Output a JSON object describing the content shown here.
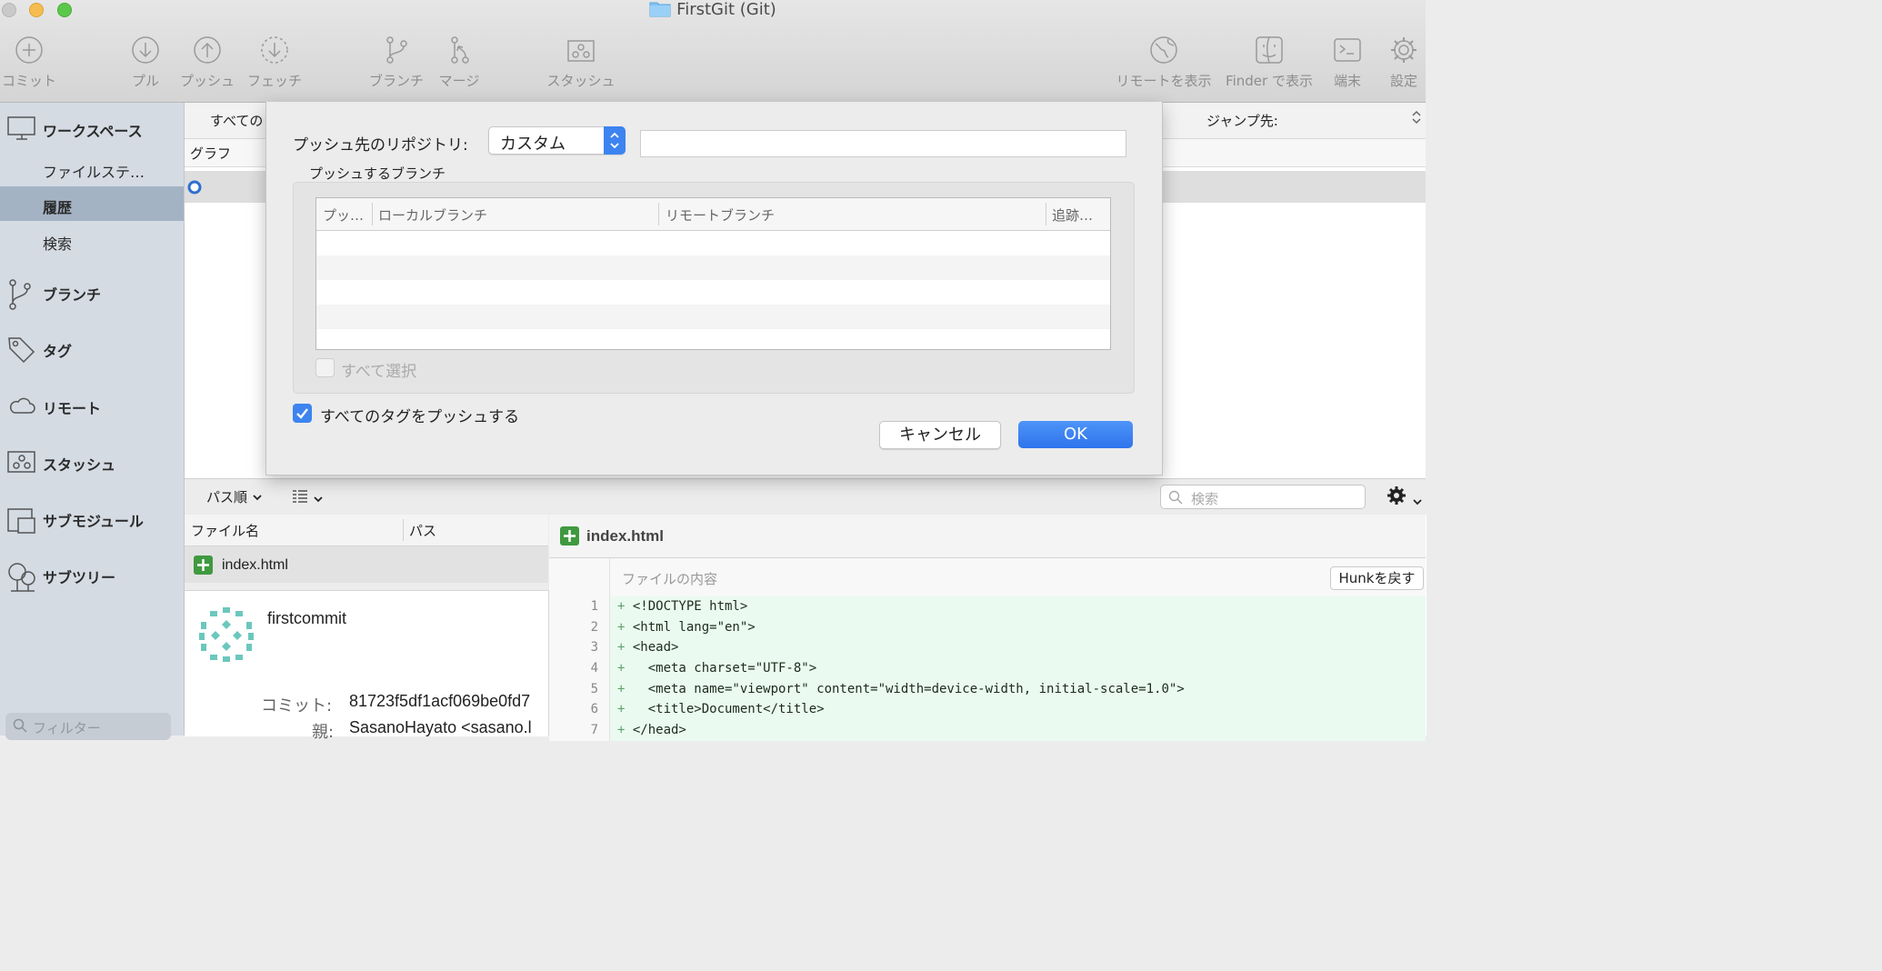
{
  "window": {
    "title": "FirstGit (Git)"
  },
  "toolbar": {
    "commit": "コミット",
    "pull": "プル",
    "push": "プッシュ",
    "fetch": "フェッチ",
    "branch": "ブランチ",
    "merge": "マージ",
    "stash": "スタッシュ",
    "show_remote": "リモートを表示",
    "show_finder": "Finder で表示",
    "terminal": "端末",
    "settings": "設定"
  },
  "sidebar": {
    "workspace": "ワークスペース",
    "file_status": "ファイルステ…",
    "history": "履歴",
    "search": "検索",
    "branches": "ブランチ",
    "tags": "タグ",
    "remotes": "リモート",
    "stashes": "スタッシュ",
    "submodules": "サブモジュール",
    "subtrees": "サブツリー",
    "filter_placeholder": "フィルター"
  },
  "main": {
    "branch_filter": "すべての",
    "jump_label": "ジャンプ先:",
    "graph_col": "グラフ"
  },
  "dialog": {
    "repo_label": "プッシュ先のリポジトリ:",
    "repo_value": "カスタム",
    "repo_url": "",
    "branches_group_label": "プッシュするブランチ",
    "col_push": "プッ…",
    "col_local": "ローカルブランチ",
    "col_remote": "リモートブランチ",
    "col_track": "追跡…",
    "select_all": "すべて選択",
    "select_all_checked": false,
    "push_tags": "すべてのタグをプッシュする",
    "push_tags_checked": true,
    "cancel": "キャンセル",
    "ok": "OK"
  },
  "bottom": {
    "sort_label": "パス順",
    "search_placeholder": "検索",
    "col_filename": "ファイル名",
    "col_path": "パス",
    "file_name": "index.html",
    "diff_file": "index.html",
    "file_content_label": "ファイルの内容",
    "revert_hunk": "Hunkを戻す"
  },
  "commit": {
    "message": "firstcommit",
    "commit_label": "コミット:",
    "commit_hash": "81723f5df1acf069be0fd7",
    "parent_label": "親:",
    "author": "SasanoHayato <sasano.l"
  },
  "diff_lines": [
    {
      "num": "1",
      "text": "<!DOCTYPE html>"
    },
    {
      "num": "2",
      "text": "<html lang=\"en\">"
    },
    {
      "num": "3",
      "text": "<head>"
    },
    {
      "num": "4",
      "text": "  <meta charset=\"UTF-8\">"
    },
    {
      "num": "5",
      "text": "  <meta name=\"viewport\" content=\"width=device-width, initial-scale=1.0\">"
    },
    {
      "num": "6",
      "text": "  <title>Document</title>"
    },
    {
      "num": "7",
      "text": "</head>"
    }
  ],
  "colors": {
    "accent": "#3d84f0",
    "sidebar_bg": "#d4dbe3",
    "sidebar_selected": "#a4b3c4",
    "diff_added_bg": "#eafaf0",
    "added_badge": "#3f9a3f"
  }
}
